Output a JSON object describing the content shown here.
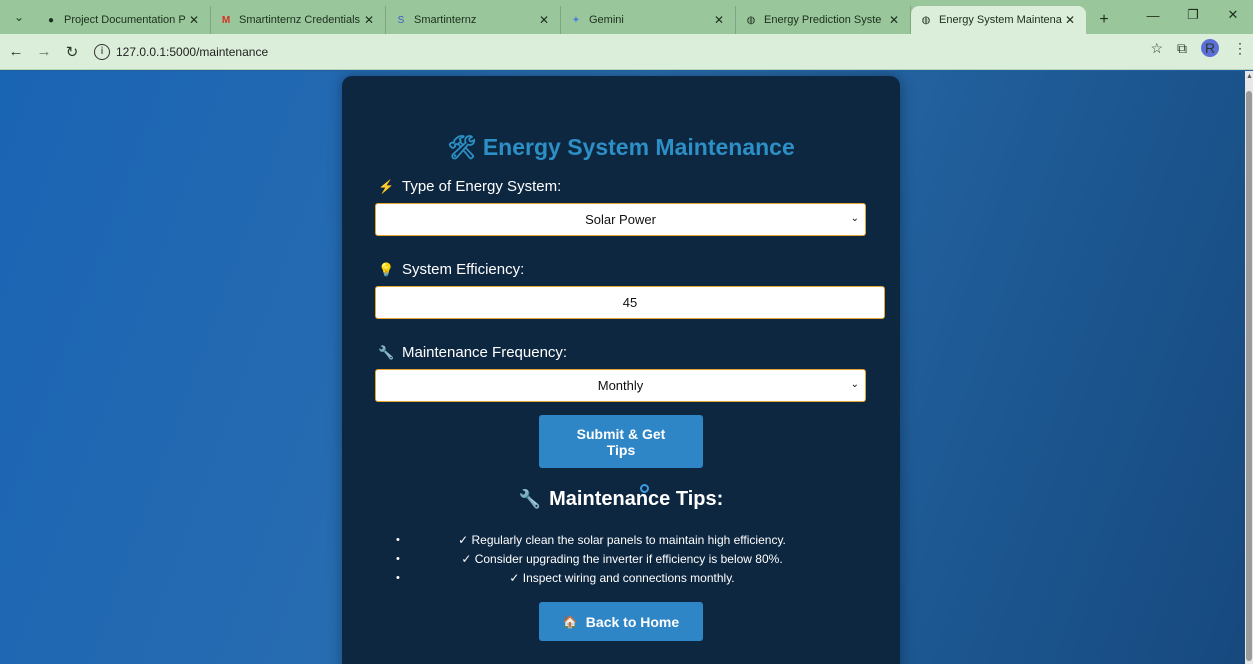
{
  "browser": {
    "tabs": [
      {
        "title": "Project Documentation Pro",
        "icon": "github-icon",
        "icon_glyph": "●",
        "icon_color": "#1d2e1d"
      },
      {
        "title": "Smartinternz Credentials fo",
        "icon": "gmail-icon",
        "icon_glyph": "M",
        "icon_color": "#d93025"
      },
      {
        "title": "Smartinternz",
        "icon": "smartinternz-icon",
        "icon_glyph": "S",
        "icon_color": "#3a5bbf"
      },
      {
        "title": "Gemini",
        "icon": "gemini-icon",
        "icon_glyph": "✦",
        "icon_color": "#4a7fe0"
      },
      {
        "title": "Energy Prediction Syste",
        "icon": "globe-icon",
        "icon_glyph": "◍",
        "icon_color": "#555555"
      },
      {
        "title": "Energy System Maintenanc",
        "icon": "globe-icon",
        "icon_glyph": "◍",
        "icon_color": "#333333",
        "active": true
      }
    ],
    "url": "127.0.0.1:5000/maintenance",
    "profile_initial": "R"
  },
  "page": {
    "title_icon": "🛠",
    "title": "Energy System Maintenance",
    "energy_type": {
      "icon": "⚡",
      "label": "Type of Energy System:",
      "value": "Solar Power"
    },
    "efficiency": {
      "icon": "💡",
      "label": "System Efficiency:",
      "value": "45"
    },
    "frequency": {
      "icon": "🔧",
      "label": "Maintenance Frequency:",
      "value": "Monthly"
    },
    "submit_label": "Submit & Get Tips",
    "tips_icon": "🔧",
    "tips_heading": "Maintenance Tips:",
    "tips": [
      "✓ Regularly clean the solar panels to maintain high efficiency.",
      "✓ Consider upgrading the inverter if efficiency is below 80%.",
      "✓ Inspect wiring and connections monthly."
    ],
    "home_icon": "🏠",
    "home_label": "Back to Home"
  },
  "colors": {
    "accent": "#2c8fc6",
    "card_bg": "#0e2741",
    "button_bg": "#2f86c6",
    "input_border": "#e7a532"
  }
}
